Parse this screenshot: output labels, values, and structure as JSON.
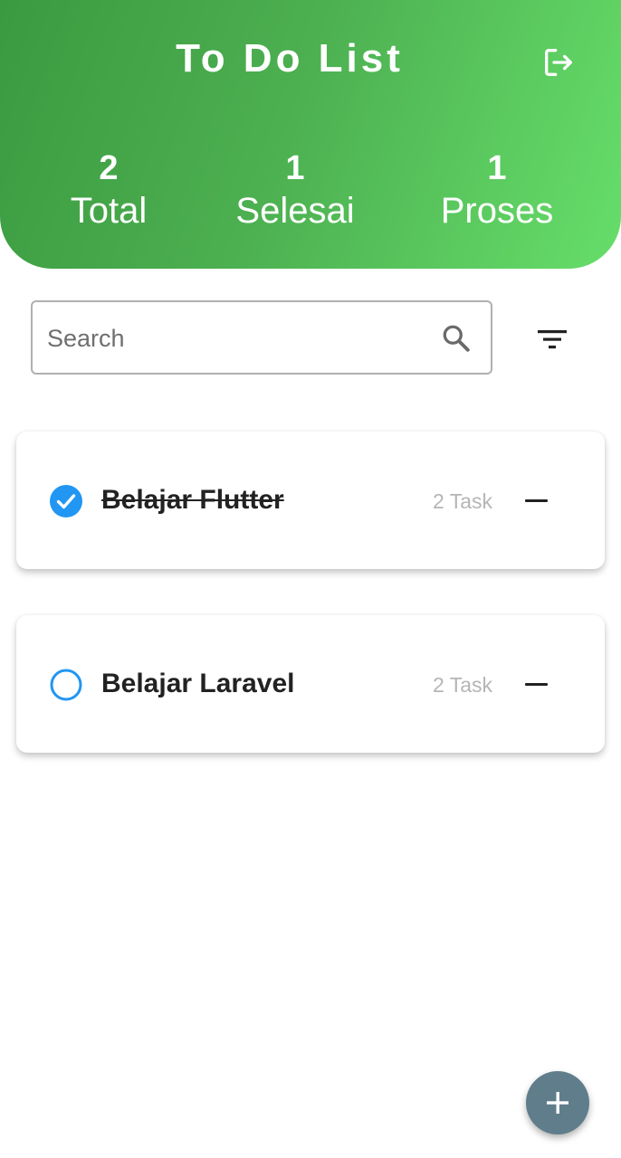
{
  "header": {
    "title": "To Do List",
    "logout_icon": "logout-icon",
    "stats": [
      {
        "value": "2",
        "label": "Total"
      },
      {
        "value": "1",
        "label": "Selesai"
      },
      {
        "value": "1",
        "label": "Proses"
      }
    ]
  },
  "search": {
    "placeholder": "Search",
    "value": "",
    "icon": "search-icon"
  },
  "filter": {
    "icon": "filter-icon"
  },
  "todos": [
    {
      "title": "Belajar Flutter",
      "task_count": "2 Task",
      "completed": true
    },
    {
      "title": "Belajar Laravel",
      "task_count": "2 Task",
      "completed": false
    }
  ],
  "fab": {
    "icon": "add-icon"
  },
  "colors": {
    "header_gradient_start": "#3a9a40",
    "header_gradient_end": "#66de6a",
    "check_blue": "#2196f3",
    "fab": "#607d8b"
  }
}
